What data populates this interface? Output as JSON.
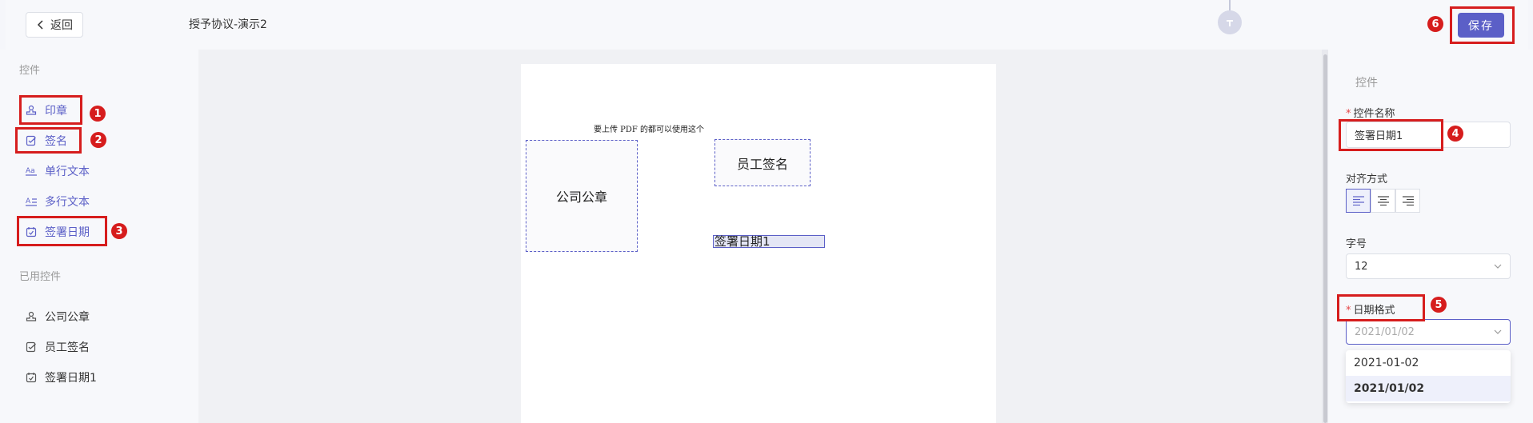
{
  "header": {
    "back_label": "返回",
    "doc_title": "授予协议-演示2",
    "save_label": "保存"
  },
  "sidebar": {
    "controls_title": "控件",
    "controls": [
      {
        "label": "印章",
        "icon": "stamp-icon"
      },
      {
        "label": "签名",
        "icon": "signature-icon"
      },
      {
        "label": "单行文本",
        "icon": "single-line-text-icon"
      },
      {
        "label": "多行文本",
        "icon": "multi-line-text-icon"
      },
      {
        "label": "签署日期",
        "icon": "sign-date-icon"
      }
    ],
    "used_title": "已用控件",
    "used": [
      {
        "label": "公司公章",
        "icon": "stamp-icon"
      },
      {
        "label": "员工签名",
        "icon": "signature-icon"
      },
      {
        "label": "签署日期1",
        "icon": "sign-date-icon"
      }
    ]
  },
  "canvas": {
    "note": "要上传 PDF 的都可以使用这个",
    "company_seal": "公司公章",
    "employee_signature": "员工签名",
    "sign_date": "签署日期1"
  },
  "panel": {
    "title": "控件",
    "name_label": "控件名称",
    "name_value": "签署日期1",
    "align_label": "对齐方式",
    "align_options": [
      "left",
      "center",
      "right"
    ],
    "align_selected": "left",
    "font_size_label": "字号",
    "font_size_value": "12",
    "date_format_label": "日期格式",
    "date_format_placeholder": "2021/01/02",
    "date_format_options": [
      "2021-01-02",
      "2021/01/02"
    ],
    "date_format_selected": "2021/01/02"
  },
  "annotations": [
    "1",
    "2",
    "3",
    "4",
    "5",
    "6"
  ],
  "colors": {
    "accent": "#5b5fc7",
    "annotation": "#d61d1d"
  }
}
